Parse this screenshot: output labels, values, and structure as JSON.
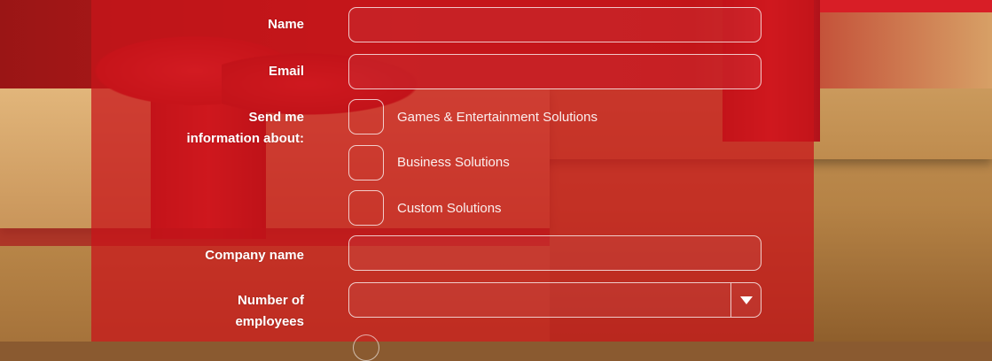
{
  "form": {
    "name_label": "Name",
    "email_label": "Email",
    "send_info_label_line1": "Send me",
    "send_info_label_line2": "information about:",
    "options": [
      {
        "label": "Games & Entertainment Solutions",
        "checked": false
      },
      {
        "label": "Business Solutions",
        "checked": false
      },
      {
        "label": "Custom Solutions",
        "checked": false
      }
    ],
    "company_label": "Company name",
    "employees_label_line1": "Number of",
    "employees_label_line2": "employees",
    "name_value": "",
    "email_value": "",
    "company_value": "",
    "employees_value": ""
  },
  "icons": {
    "select_arrow": "chevron-down-icon"
  },
  "colors": {
    "overlay": "#c8141a",
    "field_border": "#ffffff",
    "text": "#ffffff"
  }
}
